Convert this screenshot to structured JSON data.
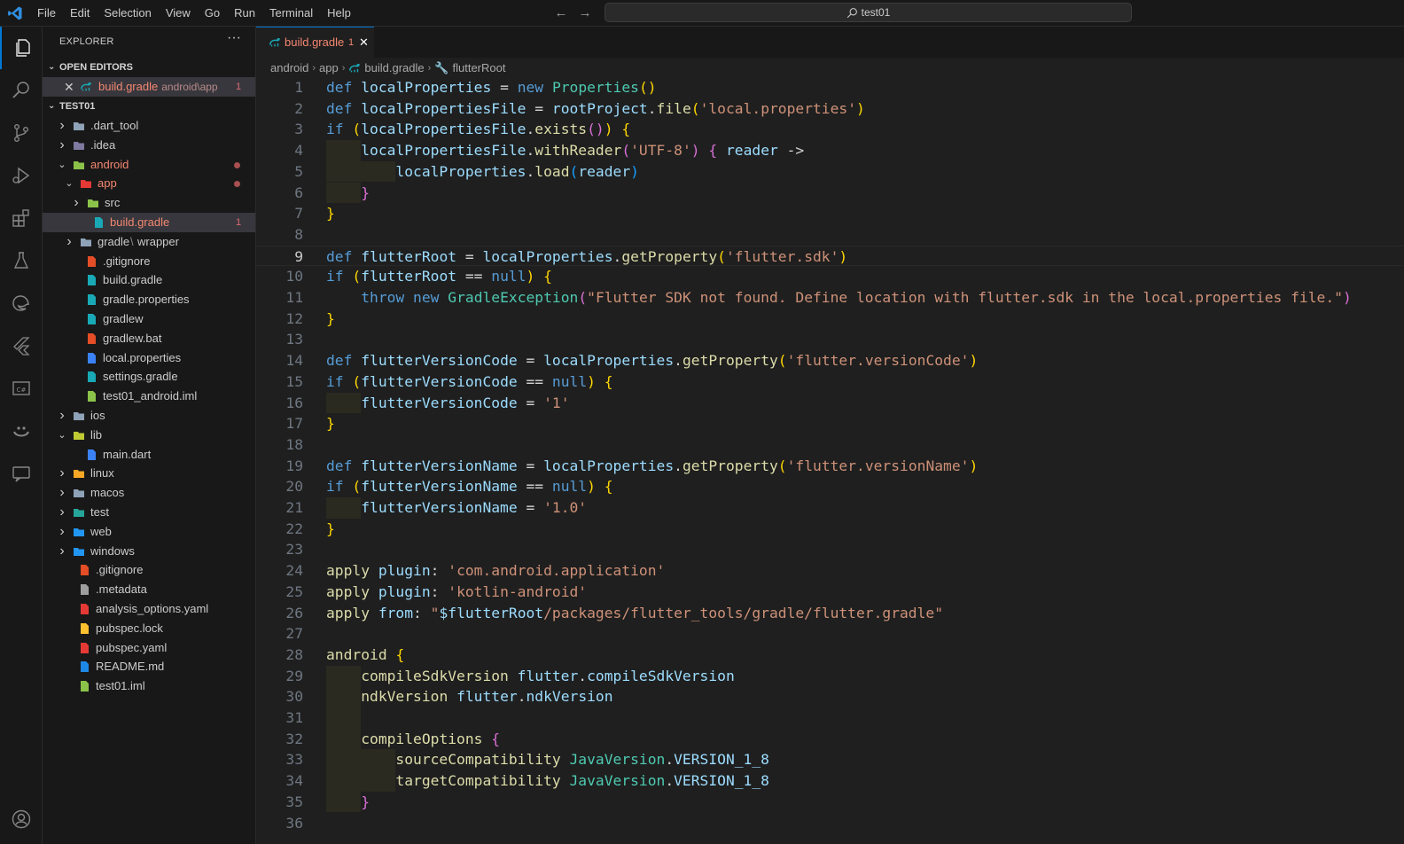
{
  "titlebar": {
    "menu": [
      "File",
      "Edit",
      "Selection",
      "View",
      "Go",
      "Run",
      "Terminal",
      "Help"
    ],
    "search": "test01"
  },
  "activity": [
    "explorer-icon",
    "search-icon",
    "source-control-icon",
    "run-debug-icon",
    "extensions-icon",
    "testing-icon",
    "edge-icon",
    "flutter-icon",
    "csharp-icon",
    "copilot-icon",
    "chat-icon",
    "account-icon"
  ],
  "sidebar": {
    "title": "EXPLORER",
    "more": "···",
    "open_editors_label": "OPEN EDITORS",
    "open_editor": {
      "name": "build.gradle",
      "path": "android\\app",
      "badge": "1"
    },
    "workspace_label": "TEST01",
    "tree": [
      {
        "name": ".dart_tool",
        "kind": "folder"
      },
      {
        "name": ".idea",
        "kind": "folder"
      },
      {
        "name": "android",
        "kind": "folder"
      },
      {
        "name": "app",
        "kind": "folder"
      },
      {
        "name": "src",
        "kind": "folder"
      },
      {
        "name": "build.gradle",
        "kind": "file",
        "badge": "1"
      },
      {
        "name": "gradle",
        "kind": "folder",
        "suffix": "wrapper"
      },
      {
        "name": ".gitignore",
        "kind": "file"
      },
      {
        "name": "build.gradle",
        "kind": "file"
      },
      {
        "name": "gradle.properties",
        "kind": "file"
      },
      {
        "name": "gradlew",
        "kind": "file"
      },
      {
        "name": "gradlew.bat",
        "kind": "file"
      },
      {
        "name": "local.properties",
        "kind": "file"
      },
      {
        "name": "settings.gradle",
        "kind": "file"
      },
      {
        "name": "test01_android.iml",
        "kind": "file"
      },
      {
        "name": "ios",
        "kind": "folder"
      },
      {
        "name": "lib",
        "kind": "folder"
      },
      {
        "name": "main.dart",
        "kind": "file"
      },
      {
        "name": "linux",
        "kind": "folder"
      },
      {
        "name": "macos",
        "kind": "folder"
      },
      {
        "name": "test",
        "kind": "folder"
      },
      {
        "name": "web",
        "kind": "folder"
      },
      {
        "name": "windows",
        "kind": "folder"
      },
      {
        "name": ".gitignore",
        "kind": "file"
      },
      {
        "name": ".metadata",
        "kind": "file"
      },
      {
        "name": "analysis_options.yaml",
        "kind": "file"
      },
      {
        "name": "pubspec.lock",
        "kind": "file"
      },
      {
        "name": "pubspec.yaml",
        "kind": "file"
      },
      {
        "name": "README.md",
        "kind": "file"
      },
      {
        "name": "test01.iml",
        "kind": "file"
      }
    ]
  },
  "editor": {
    "tab": {
      "label": "build.gradle",
      "badge": "1"
    },
    "breadcrumbs": [
      "android",
      "app",
      "build.gradle",
      "flutterRoot"
    ],
    "current_line": 9
  },
  "colors": {
    "accent": "#0078d4",
    "error": "#f48771",
    "keyword": "#569cd6",
    "string": "#ce9178"
  }
}
